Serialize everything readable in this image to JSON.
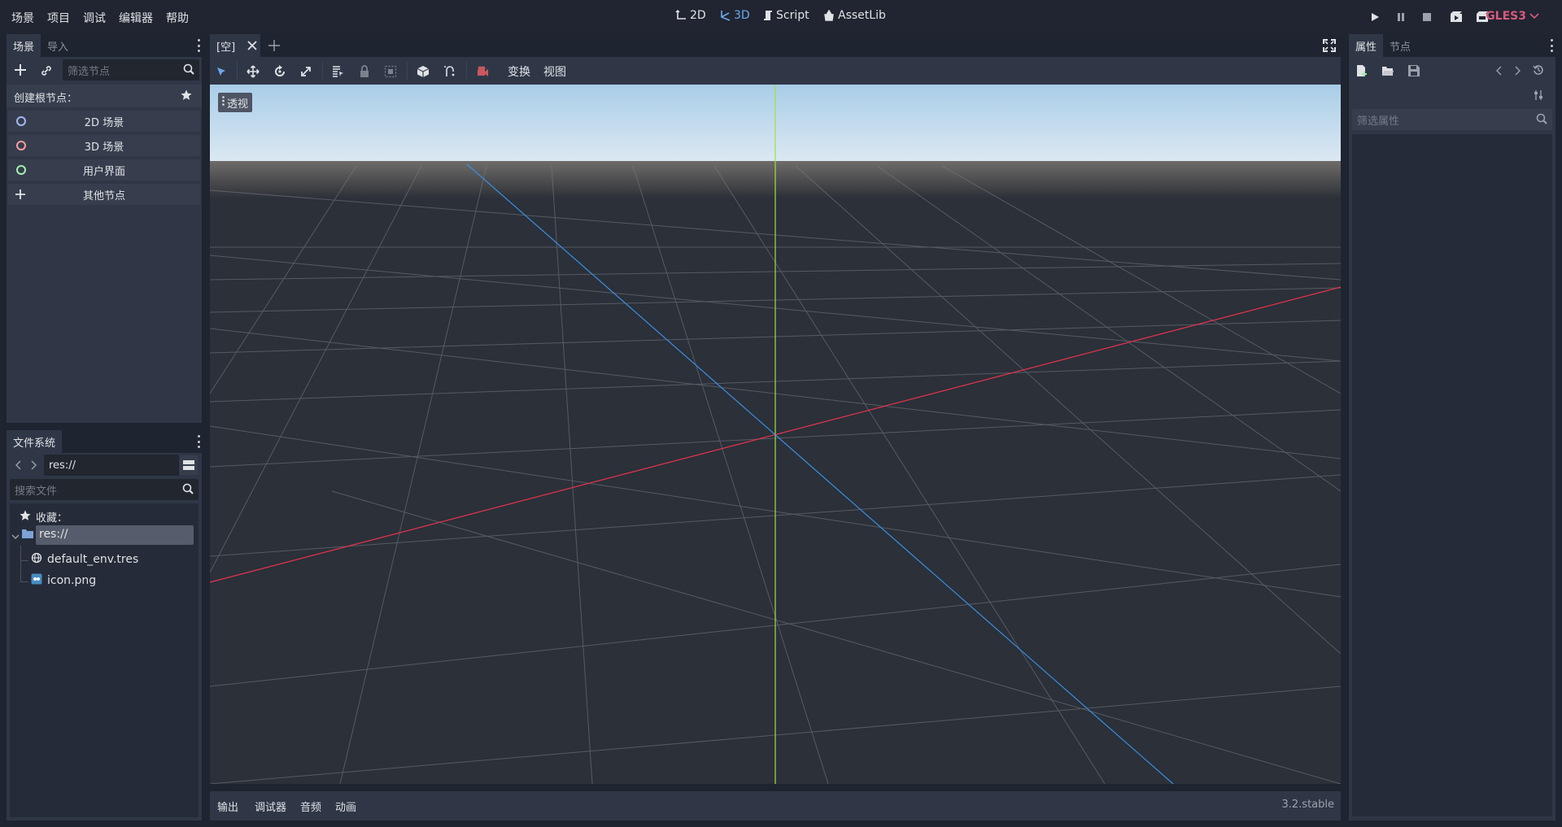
{
  "menu": [
    "场景",
    "项目",
    "调试",
    "编辑器",
    "帮助"
  ],
  "modes": [
    {
      "label": "2D",
      "icon": "2d-icon"
    },
    {
      "label": "3D",
      "icon": "3d-icon"
    },
    {
      "label": "Script",
      "icon": "script-icon"
    },
    {
      "label": "AssetLib",
      "icon": "assetlib-icon"
    }
  ],
  "renderer": "GLES3",
  "scene_dock": {
    "tabs": [
      "场景",
      "导入"
    ],
    "filter_placeholder": "筛选节点",
    "create_root_label": "创建根节点：",
    "root_options": [
      {
        "label": "2D 场景",
        "color": "#a5b7f3"
      },
      {
        "label": "3D 场景",
        "color": "#fc9c9c"
      },
      {
        "label": "用户界面",
        "color": "#a5efac"
      },
      {
        "label": "其他节点",
        "color": "#e0e2e5"
      }
    ]
  },
  "filesystem_dock": {
    "tab": "文件系统",
    "path": "res://",
    "search_placeholder": "搜索文件",
    "favorites_label": "收藏：",
    "root_folder": "res://",
    "files": [
      "default_env.tres",
      "icon.png"
    ]
  },
  "editor": {
    "scene_tab": "[空]",
    "toolbar_menus": [
      "变换",
      "视图"
    ],
    "viewport_label": "透视"
  },
  "bottom_panel": {
    "tabs": [
      "输出",
      "调试器",
      "音频",
      "动画"
    ],
    "version": "3.2.stable"
  },
  "inspector": {
    "tabs": [
      "属性",
      "节点"
    ],
    "filter_placeholder": "筛选属性"
  },
  "colors": {
    "accent": "#6fa8ee",
    "renderer": "#d9597e",
    "x_axis": "#e8334d",
    "y_axis": "#a3e03a",
    "z_axis": "#3a8fe0",
    "sky_top": "#a9cde8",
    "sky_bottom": "#dbe8f2"
  }
}
